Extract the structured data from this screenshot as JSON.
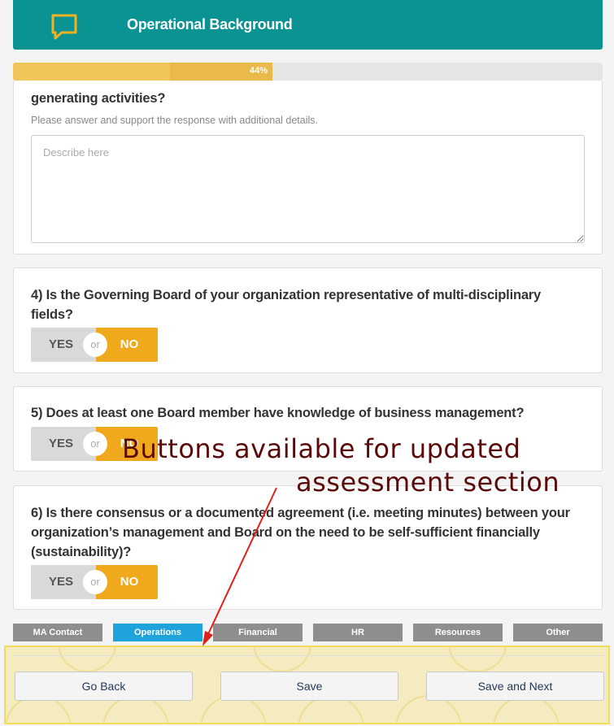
{
  "header": {
    "title": "Operational Background",
    "icon": "chat-bubble-icon",
    "accent_color": "#0b9394"
  },
  "progress": {
    "label": "44%",
    "value": 0.44,
    "color": "#e9b949"
  },
  "questions": [
    {
      "text": "generating activities?",
      "hint": "Please answer and support the response with additional details.",
      "placeholder": "Describe here"
    },
    {
      "text": "4) Is the Governing Board of your organization representative of multi-disciplinary fields?",
      "yes": "YES",
      "or": "or",
      "no": "NO"
    },
    {
      "text": "5) Does at least one Board member have knowledge of business management?",
      "yes": "YES",
      "or": "or",
      "no": "NO"
    },
    {
      "text": "6) Is there consensus or a documented agreement (i.e. meeting minutes) between your organization’s management and Board on the need to be self-sufficient financially (sustainability)?",
      "yes": "YES",
      "or": "or",
      "no": "NO"
    }
  ],
  "tabs": [
    {
      "label": "MA Contact",
      "active": false
    },
    {
      "label": "Operations",
      "active": true
    },
    {
      "label": "Financial",
      "active": false
    },
    {
      "label": "HR",
      "active": false
    },
    {
      "label": "Resources",
      "active": false
    },
    {
      "label": "Other",
      "active": false
    }
  ],
  "footer": {
    "back_label": "Go Back",
    "save_label": "Save",
    "save_next_label": "Save and Next"
  },
  "annotation": {
    "line1": "Buttons available for updated",
    "line2": "assessment section",
    "color": "#5a0a0a",
    "arrow_color": "#e0201a"
  }
}
